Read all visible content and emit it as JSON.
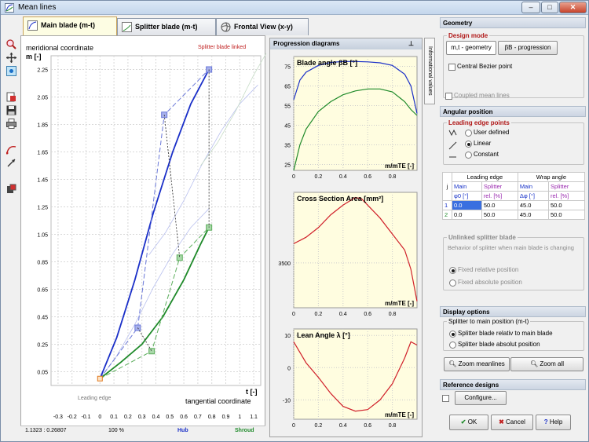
{
  "window": {
    "title": "Mean lines",
    "minimize": "–",
    "maximize": "□",
    "close": "✕"
  },
  "tabs": [
    {
      "label": "Main blade (m-t)",
      "active": true
    },
    {
      "label": "Splitter blade (m-t)",
      "active": false
    },
    {
      "label": "Frontal View (x-y)",
      "active": false
    }
  ],
  "toolbar": {
    "icons": [
      "zoom-icon",
      "pan-icon",
      "snap-icon",
      "export-icon",
      "save-icon",
      "print-icon",
      "curve-icon",
      "arrow-icon",
      "settings-icon"
    ]
  },
  "main_plot": {
    "ylabel_line1": "meridional coordinate",
    "ylabel_line2": "m [-]",
    "xlabel_line1": "t [-]",
    "xlabel_line2": "tangential coordinate",
    "linked_label": "Splitter blade linked",
    "leading_edge_label": "Leading edge",
    "y_ticks": [
      "2.25",
      "2.05",
      "1.85",
      "1.65",
      "1.45",
      "1.25",
      "1.05",
      "0.85",
      "0.65",
      "0.45",
      "0.25",
      "0.05"
    ],
    "x_ticks": [
      "-0.3",
      "-0.2",
      "-0.1",
      "0",
      "0.1",
      "0.2",
      "0.3",
      "0.4",
      "0.5",
      "0.6",
      "0.7",
      "0.8",
      "0.9",
      "1",
      "1.1"
    ],
    "xlim": [
      -0.35,
      1.15
    ],
    "ylim": [
      -0.05,
      2.35
    ],
    "hub_line": [
      [
        0.0,
        0.0
      ],
      [
        0.12,
        0.3
      ],
      [
        0.25,
        0.72
      ],
      [
        0.38,
        1.2
      ],
      [
        0.52,
        1.65
      ],
      [
        0.65,
        2.0
      ],
      [
        0.78,
        2.25
      ]
    ],
    "shroud_line": [
      [
        0.0,
        0.0
      ],
      [
        0.15,
        0.12
      ],
      [
        0.3,
        0.25
      ],
      [
        0.45,
        0.45
      ],
      [
        0.6,
        0.72
      ],
      [
        0.72,
        0.98
      ],
      [
        0.78,
        1.1
      ]
    ],
    "hub_ctrl": [
      [
        0.0,
        0.0
      ],
      [
        0.27,
        0.37
      ],
      [
        0.46,
        1.92
      ],
      [
        0.78,
        2.25
      ]
    ],
    "shroud_ctrl": [
      [
        0.0,
        0.0
      ],
      [
        0.37,
        0.2
      ],
      [
        0.57,
        0.88
      ],
      [
        0.78,
        1.1
      ]
    ],
    "colors": {
      "hub": "#1a2fc8",
      "shroud": "#1f8a2a",
      "ctrl_hub": "#6a78d8",
      "ctrl_shroud": "#5cae5c"
    }
  },
  "status": {
    "coords": "1.1323 : 0.26807",
    "zoom": "100 %",
    "hub": "Hub",
    "shroud": "Shroud"
  },
  "progression": {
    "header": "Progression diagrams",
    "pin": "📌",
    "info_tab": "Informational values",
    "charts": [
      {
        "title": "Blade angle βB [°]",
        "xlabel": "m/mTE [-]",
        "y_ticks": [
          "75",
          "65",
          "55",
          "45",
          "35",
          "25"
        ],
        "ylim": [
          22,
          80
        ],
        "x_ticks": [
          "0",
          "0.2",
          "0.4",
          "0.6",
          "0.8"
        ],
        "series": [
          {
            "color": "#1a2fc8",
            "x": [
              0,
              0.05,
              0.1,
              0.2,
              0.3,
              0.4,
              0.5,
              0.6,
              0.7,
              0.8,
              0.9,
              0.95,
              1.0
            ],
            "y": [
              58,
              68,
              72,
              75.5,
              77,
              77.5,
              77.5,
              77.3,
              76.8,
              75.5,
              71,
              65,
              51
            ]
          },
          {
            "color": "#1f8a2a",
            "x": [
              0,
              0.05,
              0.1,
              0.2,
              0.3,
              0.4,
              0.5,
              0.6,
              0.7,
              0.8,
              0.9,
              0.95,
              1.0
            ],
            "y": [
              22,
              35,
              43,
              52,
              57,
              60.5,
              62.5,
              63.5,
              63.5,
              62,
              57,
              53,
              50
            ]
          }
        ]
      },
      {
        "title": "Cross Section Area [mm²]",
        "xlabel": "m/mTE [-]",
        "y_ticks": [
          "3500"
        ],
        "ylim": [
          2800,
          4600
        ],
        "x_ticks": [
          "0",
          "0.2",
          "0.4",
          "0.6",
          "0.8"
        ],
        "series": [
          {
            "color": "#d0202a",
            "x": [
              0,
              0.05,
              0.1,
              0.2,
              0.3,
              0.4,
              0.5,
              0.55,
              0.6,
              0.7,
              0.8,
              0.9,
              0.95,
              1.0
            ],
            "y": [
              3800,
              3850,
              3900,
              4050,
              4250,
              4400,
              4520,
              4500,
              4400,
              4200,
              3950,
              3700,
              3400,
              2900
            ]
          }
        ]
      },
      {
        "title": "Lean Angle λ [°]",
        "xlabel": "m/mTE [-]",
        "y_ticks": [
          "10",
          "0",
          "-10"
        ],
        "ylim": [
          -16,
          12
        ],
        "x_ticks": [
          "0",
          "0.2",
          "0.4",
          "0.6",
          "0.8"
        ],
        "series": [
          {
            "color": "#d0202a",
            "x": [
              0,
              0.1,
              0.2,
              0.3,
              0.4,
              0.5,
              0.6,
              0.7,
              0.8,
              0.9,
              0.95,
              1.0
            ],
            "y": [
              8,
              1.5,
              -3,
              -8,
              -12,
              -13.5,
              -13,
              -10,
              -5,
              3,
              8,
              7
            ]
          }
        ]
      }
    ]
  },
  "right": {
    "geometry_header": "Geometry",
    "design_mode_label": "Design mode",
    "mode_tab_1": "m,t - geometry",
    "mode_tab_2": "βB - progression",
    "central_bezier": "Central Bezier point",
    "coupled_mean_lines": "Coupled mean lines",
    "angular_header": "Angular position",
    "leading_edge_points": "Leading edge points",
    "le_options": [
      "User defined",
      "Linear",
      "Constant"
    ],
    "table": {
      "head_j": "j",
      "head_le": "Leading edge",
      "head_wrap": "Wrap angle",
      "sub": [
        "Main",
        "Splitter",
        "Main",
        "Splitter"
      ],
      "units": [
        "φ0 [°]",
        "rel. [%]",
        "Δφ [°]",
        "rel. [%]"
      ],
      "rows": [
        [
          "1",
          "0.0",
          "50.0",
          "45.0",
          "50.0"
        ],
        [
          "2",
          "0.0",
          "50.0",
          "45.0",
          "50.0"
        ]
      ]
    },
    "unlinked_label": "Unlinked splitter blade",
    "unlinked_text": "Behavior of splitter when main blade is changing",
    "unlinked_options": [
      "Fixed relative position",
      "Fixed absolute position"
    ],
    "display_header": "Display options",
    "splitter_pos_label": "Splitter to main position (m-t)",
    "splitter_options": [
      "Splitter blade relativ to main blade",
      "Splitter blade absolut position"
    ],
    "zoom_meanlines": "Zoom meanlines",
    "zoom_all": "Zoom all",
    "ref_header": "Reference designs",
    "configure": "Configure...",
    "ok": "OK",
    "cancel": "Cancel",
    "help": "Help"
  }
}
